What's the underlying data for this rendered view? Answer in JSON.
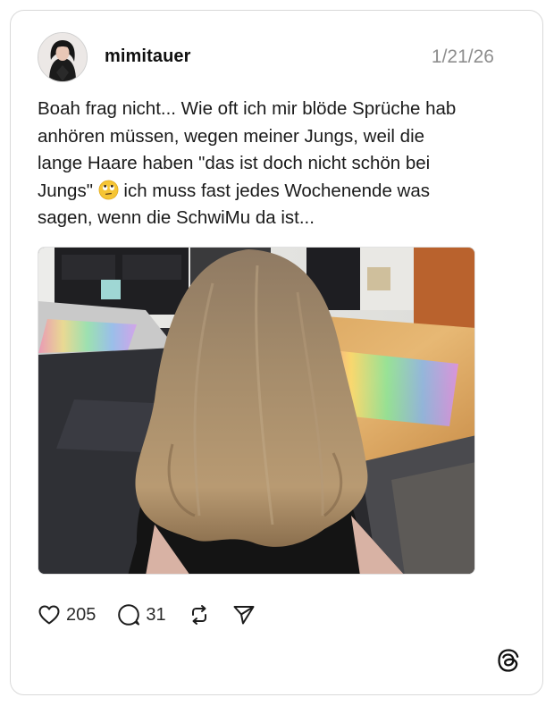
{
  "post": {
    "username": "mimitauer",
    "date": "1/21/26",
    "text_lines": [
      "Boah frag nicht... Wie oft ich mir blöde Sprüche hab",
      "anhören müssen, wegen meiner Jungs, weil die",
      "lange Haare haben \"das ist doch nicht schön bei",
      "Jungs\"",
      "ich muss fast jedes Wochenende was",
      "sagen, wenn die SchwiMu da ist..."
    ],
    "emoji": "face-with-rolling-eyes"
  },
  "actions": {
    "likes": "205",
    "replies": "31",
    "repost_icon": "repost-icon",
    "share_icon": "send-icon"
  },
  "brand": {
    "logo": "threads-logo-icon",
    "accent": "#101010"
  }
}
